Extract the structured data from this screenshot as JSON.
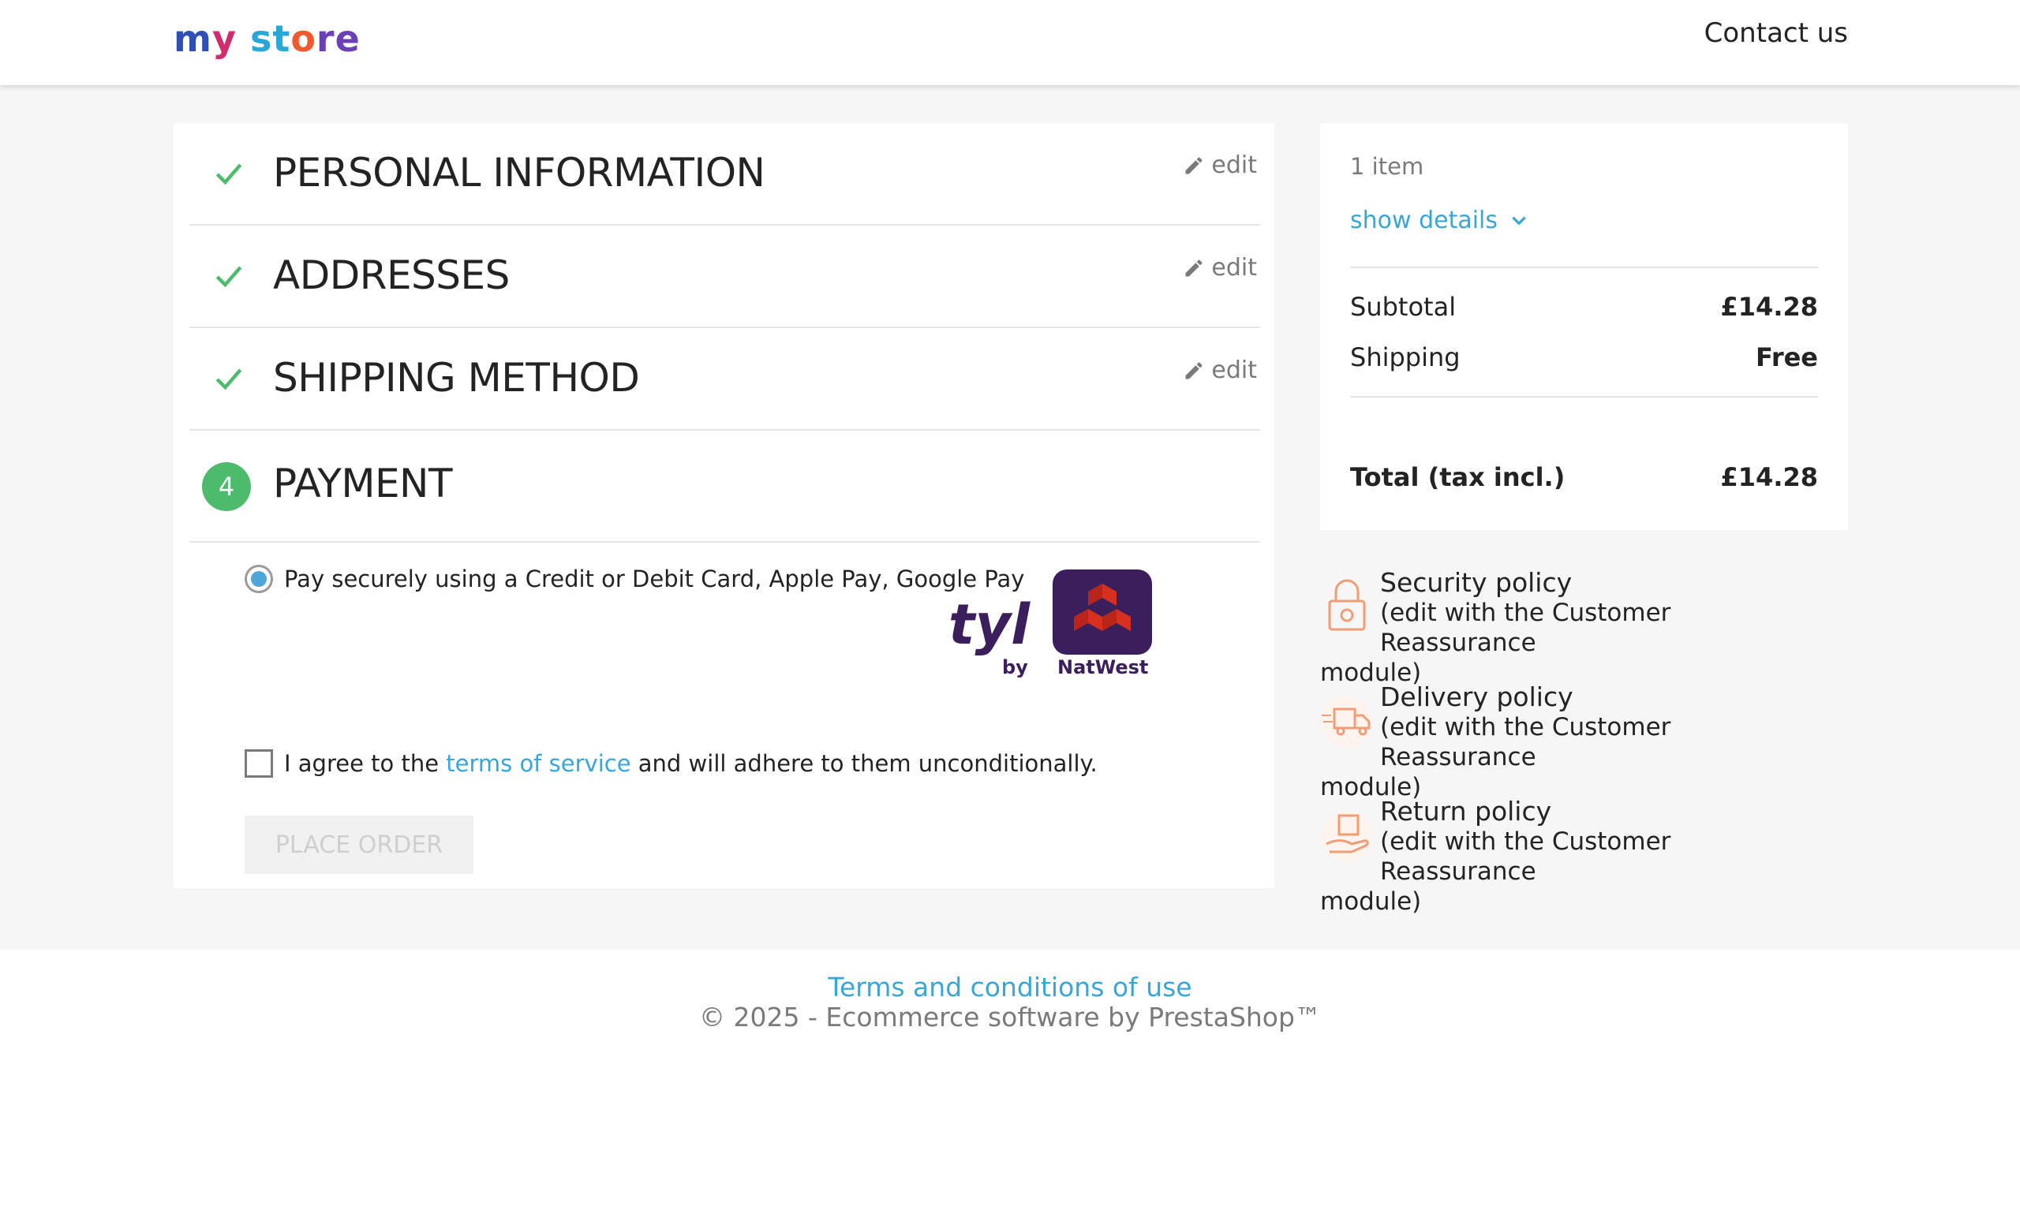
{
  "header": {
    "logo_parts": [
      "m",
      "y ",
      "st",
      "o",
      "re"
    ],
    "contact_label": "Contact us"
  },
  "steps": [
    {
      "title": "PERSONAL INFORMATION",
      "edit_label": "edit",
      "status": "complete"
    },
    {
      "title": "ADDRESSES",
      "edit_label": "edit",
      "status": "complete"
    },
    {
      "title": "SHIPPING METHOD",
      "edit_label": "edit",
      "status": "complete"
    },
    {
      "title": "PAYMENT",
      "number": "4",
      "status": "current"
    }
  ],
  "payment": {
    "option_label": "Pay securely using a Credit or Debit Card, Apple Pay, Google Pay",
    "logo_text": "tyl",
    "logo_by": "by",
    "logo_brand": "NatWest",
    "agree_prefix": "I agree to the ",
    "agree_link": "terms of service",
    "agree_suffix": " and will adhere to them unconditionally.",
    "place_order_label": "PLACE ORDER"
  },
  "summary": {
    "items_count": "1 item",
    "show_details": "show details",
    "subtotal_label": "Subtotal",
    "subtotal_value": "£14.28",
    "shipping_label": "Shipping",
    "shipping_value": "Free",
    "total_label": "Total (tax incl.)",
    "total_value": "£14.28"
  },
  "reassurance": [
    {
      "title": "Security policy",
      "line2": "(edit with the Customer Reassurance",
      "line3": "module)",
      "icon": "lock-icon"
    },
    {
      "title": "Delivery policy",
      "line2": "(edit with the Customer Reassurance",
      "line3": "module)",
      "icon": "truck-icon"
    },
    {
      "title": "Return policy",
      "line2": "(edit with the Customer Reassurance",
      "line3": "module)",
      "icon": "return-box-icon"
    }
  ],
  "footer": {
    "terms_link": "Terms and conditions of use",
    "copyright": "© 2025 - Ecommerce software by PrestaShop™"
  },
  "colors": {
    "accent": "#3aa6d6",
    "success": "#4cbb6c",
    "brand_purple": "#3a1f5c",
    "natwest_red": "#d8301e",
    "reassure_orange": "#f19d76"
  }
}
